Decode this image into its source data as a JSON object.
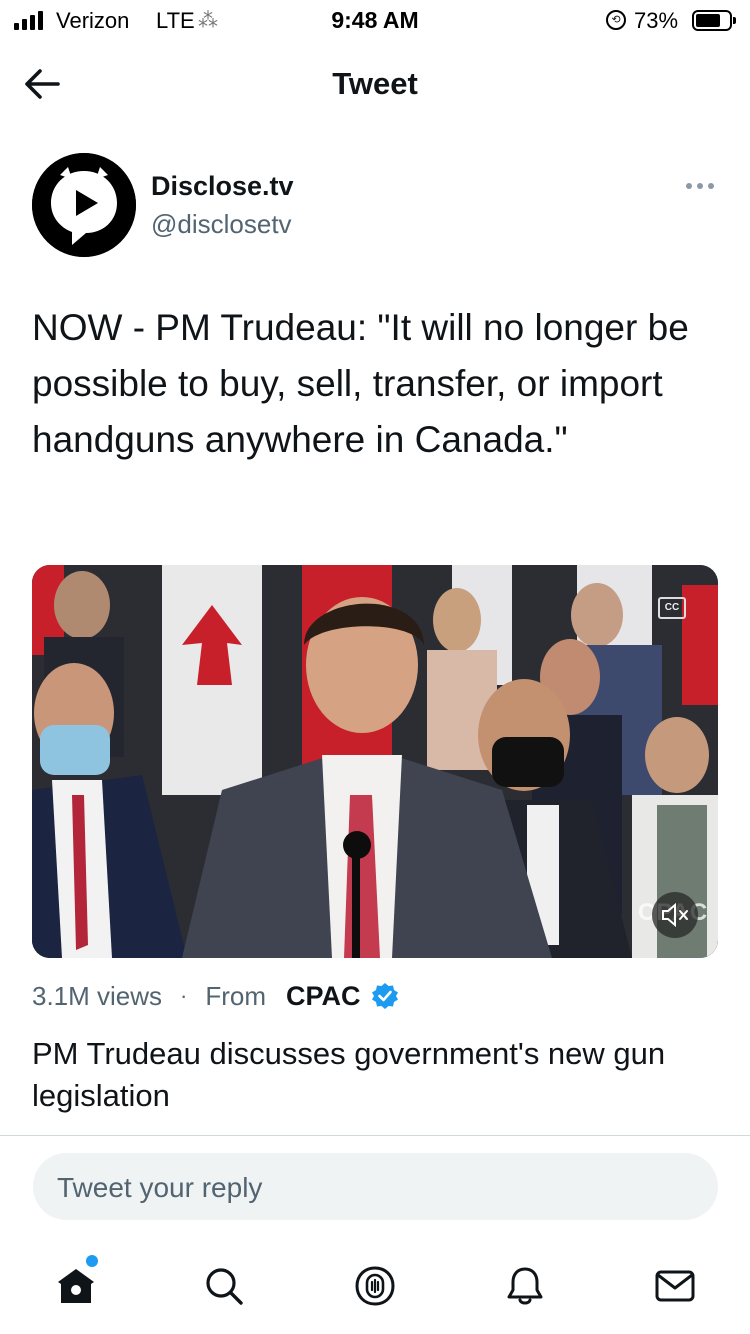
{
  "status_bar": {
    "carrier": "Verizon",
    "network": "LTE",
    "time": "9:48 AM",
    "battery_percent": "73%",
    "battery_level": 0.73,
    "signal_bars": 4
  },
  "header": {
    "title": "Tweet",
    "back_icon": "arrow-left-icon"
  },
  "tweet": {
    "author": {
      "name": "Disclose.tv",
      "handle": "@disclosetv",
      "avatar_icon": "play-bubble-logo"
    },
    "text": "NOW - PM Trudeau: \"It will no longer be possible to buy, sell, transfer, or import handguns anywhere in Canada.\"",
    "media": {
      "type": "video",
      "caption_icon": "closed-captions-icon",
      "mute_icon": "speaker-muted-icon",
      "watermark": "CPAC"
    },
    "media_meta": {
      "views": "3.1M views",
      "separator": "·",
      "from_label": "From",
      "source": "CPAC",
      "source_verified": true
    },
    "media_title": "PM Trudeau discusses government's new gun legislation"
  },
  "reply": {
    "placeholder": "Tweet your reply"
  },
  "tab_bar": {
    "items": [
      {
        "name": "home",
        "icon": "home-icon",
        "has_notification": true
      },
      {
        "name": "search",
        "icon": "search-icon"
      },
      {
        "name": "spaces",
        "icon": "spaces-icon"
      },
      {
        "name": "notifications",
        "icon": "bell-icon"
      },
      {
        "name": "messages",
        "icon": "mail-icon"
      }
    ]
  },
  "colors": {
    "accent": "#1d9bf0",
    "text_primary": "#0f1419",
    "text_secondary": "#536471",
    "reply_bg": "#eff3f4"
  }
}
